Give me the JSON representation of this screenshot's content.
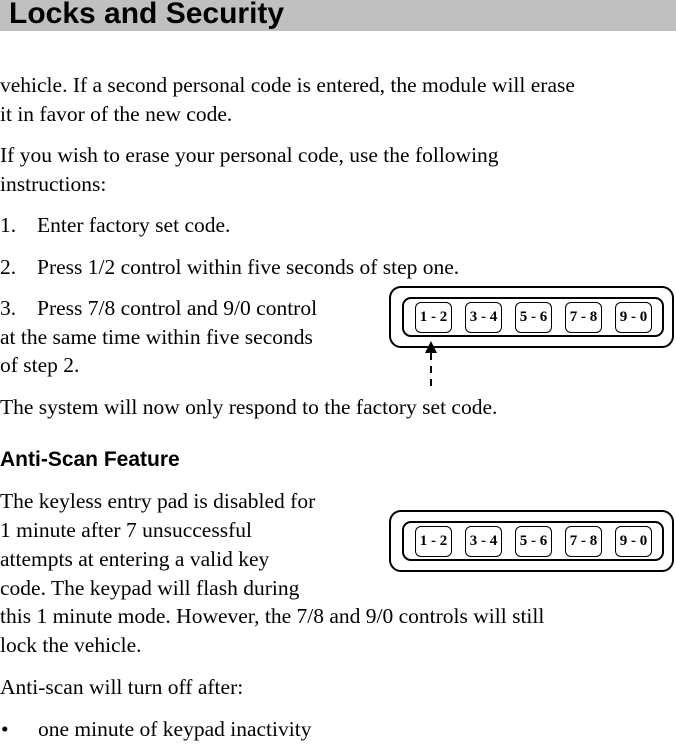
{
  "header": {
    "title": "Locks and Security",
    "background_color": "#c0c0c0"
  },
  "paragraphs": {
    "p1_line1": "vehicle. If a second personal code is entered, the module will erase",
    "p1_line2": "it in favor of the new code.",
    "p2_line1": "If you wish to erase your personal code, use the following",
    "p2_line2": "instructions:"
  },
  "steps": [
    {
      "number": "1.",
      "text": "Enter factory set code."
    },
    {
      "number": "2.",
      "text": "Press 1/2 control within five seconds of step one."
    },
    {
      "number": "3.",
      "text": "Press 7/8 control and 9/0 control",
      "continuation": [
        "at the same time within five seconds",
        "of step 2."
      ]
    }
  ],
  "after_steps": "The system will now only respond to the factory set code.",
  "anti_scan": {
    "heading": "Anti-Scan Feature",
    "lines": [
      "The keyless entry pad is disabled for",
      "1 minute after 7 unsuccessful",
      "attempts at entering a valid key",
      "code. The keypad will flash during",
      "this 1 minute mode. However, the 7/8 and 9/0 controls will still",
      "lock the vehicle."
    ],
    "turn_off_intro": "Anti-scan will turn off after:",
    "bullets": [
      {
        "symbol": "•",
        "text": "one minute of keypad inactivity"
      }
    ]
  },
  "keypad_top": {
    "keys": [
      "1 - 2",
      "3 - 4",
      "5 - 6",
      "7 - 8",
      "9 - 0"
    ],
    "highlighted_key": "1 - 2",
    "pointer_icon": "dashed-arrow-up-icon"
  },
  "keypad_bottom": {
    "keys": [
      "1 - 2",
      "3 - 4",
      "5 - 6",
      "7 - 8",
      "9 - 0"
    ]
  }
}
